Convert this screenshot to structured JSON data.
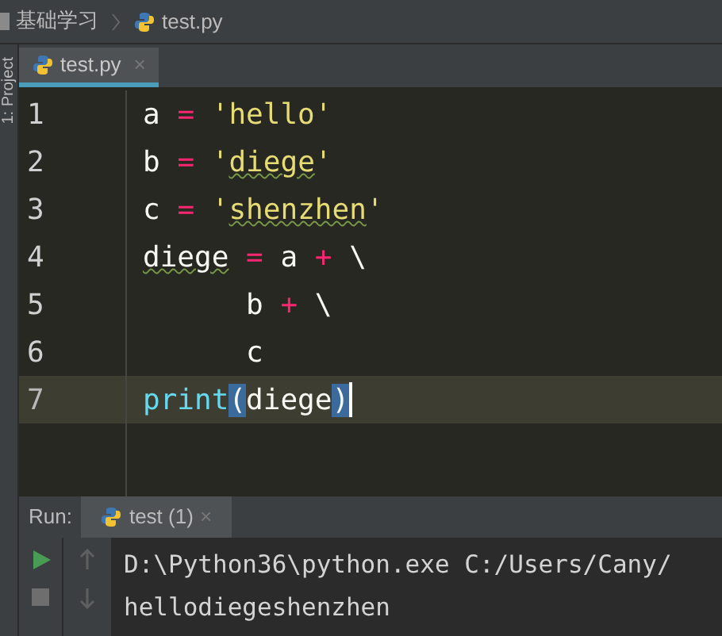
{
  "breadcrumb": {
    "folder": "基础学习",
    "file": "test.py"
  },
  "side_strip": {
    "label": "1: Project"
  },
  "editor_tabs": [
    {
      "label": "test.py",
      "close": "×",
      "selected": true
    }
  ],
  "editor": {
    "lines": [
      {
        "number": "1",
        "current": false,
        "tokens": [
          {
            "kind": "plain",
            "text": "a "
          },
          {
            "kind": "op",
            "text": "="
          },
          {
            "kind": "string",
            "text": " 'hello'"
          }
        ]
      },
      {
        "number": "2",
        "current": false,
        "tokens": [
          {
            "kind": "plain",
            "text": "b "
          },
          {
            "kind": "op",
            "text": "="
          },
          {
            "kind": "string",
            "text": " '"
          },
          {
            "kind": "string",
            "text": "diege",
            "typo": true
          },
          {
            "kind": "string",
            "text": "'"
          }
        ]
      },
      {
        "number": "3",
        "current": false,
        "tokens": [
          {
            "kind": "plain",
            "text": "c "
          },
          {
            "kind": "op",
            "text": "="
          },
          {
            "kind": "string",
            "text": " '"
          },
          {
            "kind": "string",
            "text": "shenzhen",
            "typo": true
          },
          {
            "kind": "string",
            "text": "'"
          }
        ]
      },
      {
        "number": "4",
        "current": false,
        "tokens": [
          {
            "kind": "plain",
            "text": "diege",
            "typo": true
          },
          {
            "kind": "op",
            "text": " ="
          },
          {
            "kind": "plain",
            "text": " a "
          },
          {
            "kind": "op",
            "text": "+"
          },
          {
            "kind": "plain",
            "text": " \\"
          }
        ]
      },
      {
        "number": "5",
        "current": false,
        "tokens": [
          {
            "kind": "plain",
            "text": "      b "
          },
          {
            "kind": "op",
            "text": "+"
          },
          {
            "kind": "plain",
            "text": " \\"
          }
        ]
      },
      {
        "number": "6",
        "current": false,
        "tokens": [
          {
            "kind": "plain",
            "text": "      c"
          }
        ]
      },
      {
        "number": "7",
        "current": true,
        "tokens": [
          {
            "kind": "builtin",
            "text": "print"
          },
          {
            "kind": "match",
            "text": "("
          },
          {
            "kind": "plain",
            "text": "diege"
          },
          {
            "kind": "match",
            "text": ")"
          }
        ]
      }
    ]
  },
  "run_panel": {
    "label": "Run:",
    "tabs": [
      {
        "label": "test (1)",
        "close": "×",
        "selected": true
      }
    ],
    "output": [
      "D:\\Python36\\python.exe C:/Users/Cany/",
      "hellodiegeshenzhen"
    ]
  }
}
